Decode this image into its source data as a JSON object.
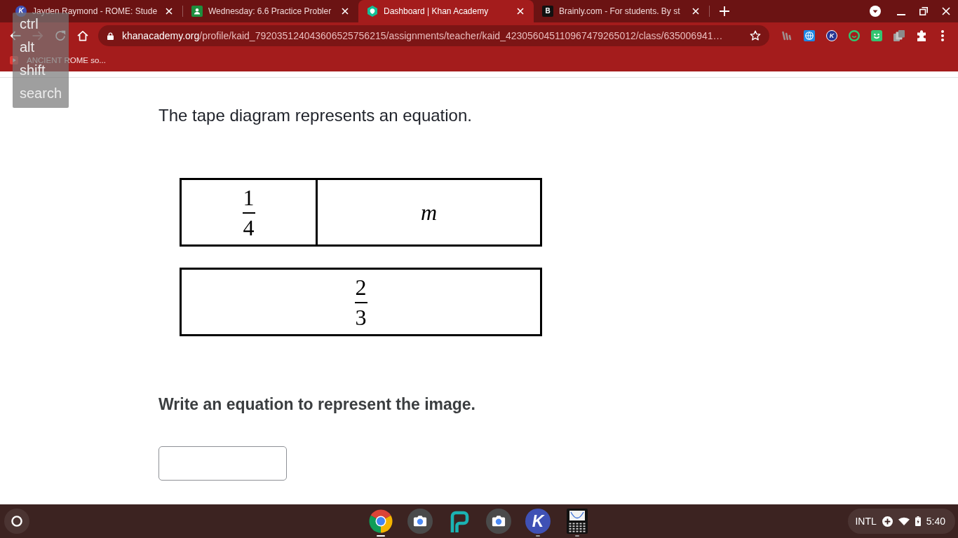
{
  "tabs": [
    {
      "title": "Jayden Raymond - ROME: Stude",
      "selected": false,
      "logo_letter": "K"
    },
    {
      "title": "Wednesday: 6.6 Practice Probler",
      "selected": false
    },
    {
      "title": "Dashboard | Khan Academy",
      "selected": true
    },
    {
      "title": "Brainly.com - For students. By st",
      "selected": false,
      "logo_letter": "B"
    }
  ],
  "toolbar": {
    "forward_disabled": true,
    "url_host": "khanacademy.org",
    "url_path": "/profile/kaid_792035124043606525756215/assignments/teacher/kaid_423056045110967479265012/class/635006941…",
    "extension_letter": "K"
  },
  "bookmarks": [
    {
      "title": "ANCIENT ROME so..."
    }
  ],
  "key_overlay": {
    "keys": [
      "ctrl",
      "alt",
      "shift",
      "search"
    ]
  },
  "exercise": {
    "prompt": "The tape diagram represents an equation.",
    "tape_diagram": {
      "rows": [
        {
          "segments": [
            {
              "kind": "fraction",
              "numerator": "1",
              "denominator": "4"
            },
            {
              "kind": "variable",
              "text": "m"
            }
          ]
        },
        {
          "segments": [
            {
              "kind": "fraction",
              "numerator": "2",
              "denominator": "3"
            }
          ]
        }
      ]
    },
    "question": "Write an equation to represent the image."
  },
  "shelf": {
    "apps": [
      {
        "running": true,
        "focused": true
      },
      {
        "running": false,
        "focused": false
      },
      {
        "running": false,
        "focused": false
      },
      {
        "running": false,
        "focused": false
      },
      {
        "running": true,
        "focused": false,
        "logo_letter": "K"
      },
      {
        "running": true,
        "focused": false
      }
    ]
  },
  "status_area": {
    "keyboard_layout": "INTL",
    "time": "5:40"
  }
}
